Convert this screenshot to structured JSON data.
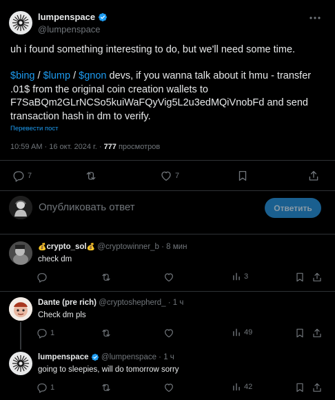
{
  "main_tweet": {
    "display_name": "lumpenspace",
    "handle": "@lumpenspace",
    "line1": "uh i found something interesting to do, but we'll need some time.",
    "cashtag_bing": "$bing",
    "slash1": " / ",
    "cashtag_lump": "$lump",
    "slash2": " / ",
    "cashtag_gnon": "$gnon",
    "body_rest1": " devs, if you wanna talk about it hmu - transfer",
    "body_line3": ".01$ from the original coin creation wallets to",
    "body_line4": "F7SaBQm2GLrNCSo5kuiWaFQyVig5L2u3edMQiVnobFd and send",
    "body_line5": "transaction hash in dm to verify.",
    "translate": "Перевести пост",
    "time": "10:59 AM · 16 окт. 2024 г. · ",
    "views_count": "777",
    "views_label": " просмотров",
    "replies": "7",
    "likes": "7",
    "more_icon": "ellipsis-icon"
  },
  "composer": {
    "placeholder": "Опубликовать ответ",
    "reply_button": "Ответить"
  },
  "replies": [
    {
      "name_prefix": "💰",
      "display_name": "crypto_sol",
      "name_suffix": "💰",
      "handle_time": "@cryptowinner_b · 8 мин",
      "text": "check dm",
      "replies": "",
      "retweets": "",
      "likes": "",
      "views": "3"
    },
    {
      "display_name": "Dante (pre rich)",
      "handle_time": "@cryptoshepherd_ · 1 ч",
      "text": "Check dm pls",
      "replies": "1",
      "retweets": "",
      "likes": "",
      "views": "49"
    },
    {
      "display_name": "lumpenspace",
      "handle_time": "@lumpenspace · 1 ч",
      "text": "going to sleepies, will do tomorrow sorry",
      "replies": "1",
      "retweets": "",
      "likes": "",
      "views": "42"
    }
  ],
  "colors": {
    "background": "#000000",
    "text": "#e7e9ea",
    "muted": "#71767b",
    "link": "#1d9bf0",
    "reply_button": "#1a5f8f",
    "divider": "#2f3336"
  }
}
